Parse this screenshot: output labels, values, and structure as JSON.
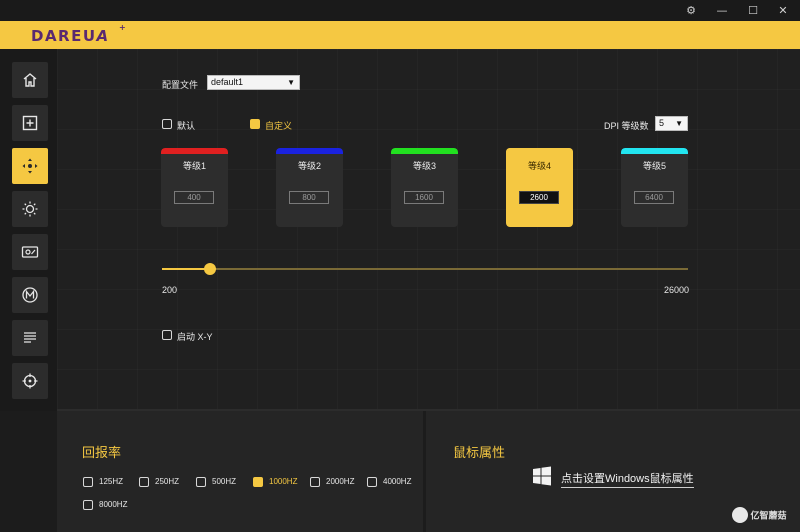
{
  "window": {
    "settings_icon": "gear-icon",
    "minimize_glyph": "—",
    "maximize_glyph": "☐",
    "close_glyph": "✕"
  },
  "brand": {
    "logo_text": "DAREU",
    "logo_mark": "A",
    "logo_plus": "+"
  },
  "sidebar": {
    "items": [
      {
        "icon": "home-icon"
      },
      {
        "icon": "macro-plus-icon"
      },
      {
        "icon": "dpi-crosshair-icon"
      },
      {
        "icon": "light-sun-icon"
      },
      {
        "icon": "sensor-icon"
      },
      {
        "icon": "macro-m-icon"
      },
      {
        "icon": "list-icon"
      },
      {
        "icon": "target-icon"
      }
    ],
    "active_index": 2
  },
  "dpi": {
    "profile_label": "配置文件",
    "profile_value": "default1",
    "default_label": "默认",
    "custom_label": "自定义",
    "custom_checked": true,
    "levels_label": "DPI 等级数",
    "levels_value": "5",
    "cards": [
      {
        "title": "等级1",
        "value": "400",
        "color": "#e02020"
      },
      {
        "title": "等级2",
        "value": "800",
        "color": "#1a22e0"
      },
      {
        "title": "等级3",
        "value": "1600",
        "color": "#22e020"
      },
      {
        "title": "等级4",
        "value": "2600",
        "color": "#f5c842"
      },
      {
        "title": "等级5",
        "value": "6400",
        "color": "#22e5f0"
      }
    ],
    "active_card": 3,
    "slider": {
      "min_label": "200",
      "max_label": "26000",
      "position_fraction": 0.092
    },
    "xy_label": "启动 X-Y"
  },
  "polling": {
    "title": "回报率",
    "options": [
      "125HZ",
      "250HZ",
      "500HZ",
      "1000HZ",
      "2000HZ",
      "4000HZ",
      "8000HZ"
    ],
    "selected": "1000HZ"
  },
  "mouse_props": {
    "title": "鼠标属性",
    "link_text": "点击设置Windows鼠标属性"
  },
  "watermark": {
    "text": "亿智蘑菇"
  },
  "colors": {
    "accent": "#f5c842"
  }
}
